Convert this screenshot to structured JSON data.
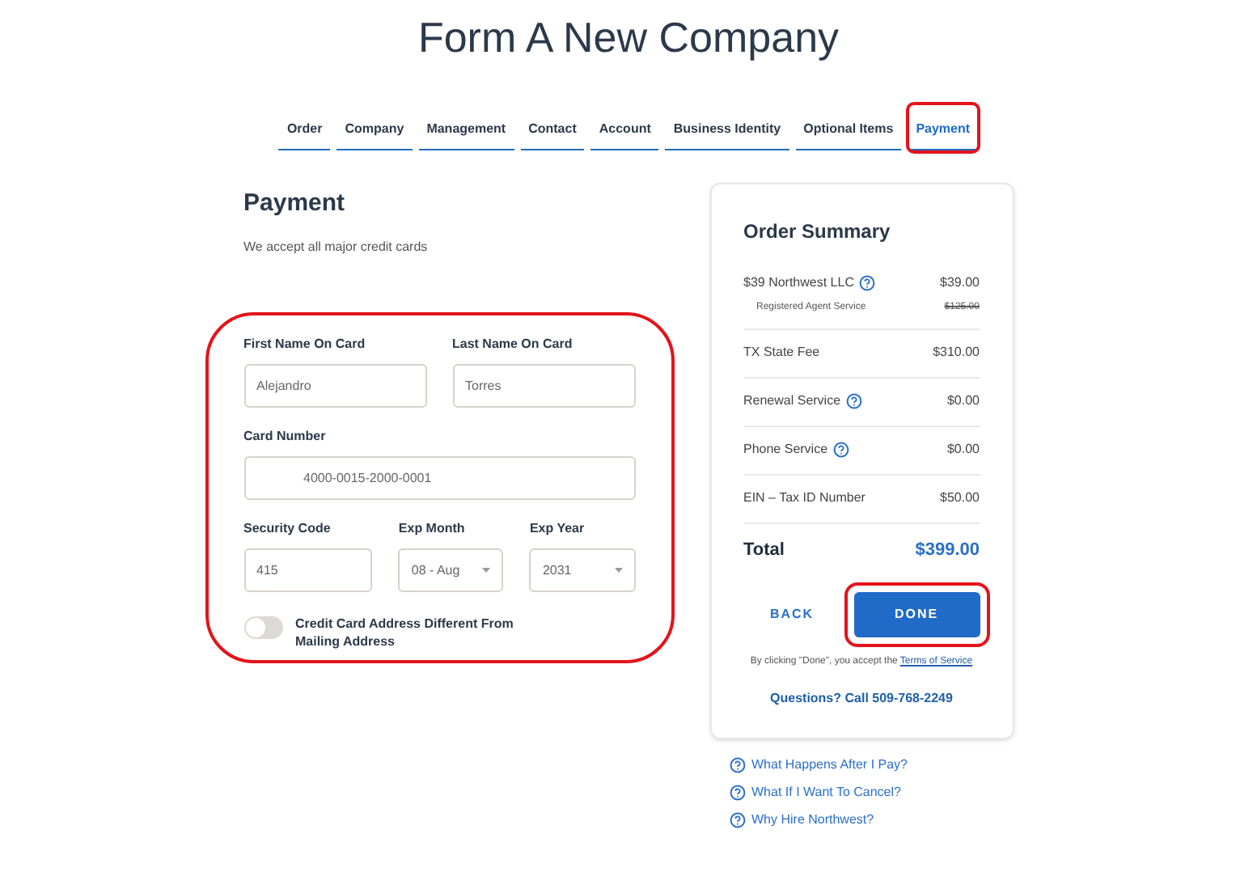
{
  "title": "Form A New Company",
  "tabs": [
    {
      "label": "Order",
      "selected": false,
      "highlighted": false
    },
    {
      "label": "Company",
      "selected": false,
      "highlighted": false
    },
    {
      "label": "Management",
      "selected": false,
      "highlighted": false
    },
    {
      "label": "Contact",
      "selected": false,
      "highlighted": false
    },
    {
      "label": "Account",
      "selected": false,
      "highlighted": false
    },
    {
      "label": "Business Identity",
      "selected": false,
      "highlighted": false
    },
    {
      "label": "Optional Items",
      "selected": false,
      "highlighted": false
    },
    {
      "label": "Payment",
      "selected": true,
      "highlighted": true
    }
  ],
  "payment": {
    "heading": "Payment",
    "note": "We accept all major credit cards"
  },
  "form": {
    "highlighted": true,
    "rows": [
      [
        {
          "label": "First Name On Card",
          "kind": "text",
          "value": "Alejandro"
        },
        {
          "label": "Last Name On Card",
          "kind": "text",
          "value": "Torres"
        }
      ],
      [
        {
          "label": "Card Number",
          "kind": "card",
          "value": "4000-0015-2000-0001"
        }
      ],
      [
        {
          "label": "Security Code",
          "kind": "text",
          "value": "415"
        },
        {
          "label": "Exp Month",
          "kind": "select",
          "value": "08 - Aug"
        },
        {
          "label": "Exp Year",
          "kind": "select",
          "value": "2031"
        }
      ]
    ],
    "toggle": {
      "label": "Credit Card Address Different From Mailing Address",
      "on": false
    }
  },
  "order_summary": {
    "heading": "Order Summary",
    "items": [
      {
        "kind": "item",
        "name": "$39 Northwest LLC",
        "amount": "$39.00",
        "info": true
      },
      {
        "kind": "sub",
        "name": "Registered Agent Service",
        "amount": "$125.00"
      },
      {
        "kind": "item",
        "name": "TX State Fee",
        "amount": "$310.00",
        "info": false
      },
      {
        "kind": "item",
        "name": "Renewal Service",
        "amount": "$0.00",
        "info": true
      },
      {
        "kind": "item",
        "name": "Phone Service",
        "amount": "$0.00",
        "info": true
      },
      {
        "kind": "item",
        "name": "EIN – Tax ID Number",
        "amount": "$50.00",
        "info": false
      }
    ],
    "total_label": "Total",
    "total": "$399.00",
    "back": "BACK",
    "done": {
      "label": "DONE",
      "highlighted": true
    },
    "terms_text": "By clicking \"Done\", you accept the",
    "terms_link": "Terms of Service",
    "questions": "Questions? Call 509-768-2249"
  },
  "help_links": [
    "What Happens After I Pay?",
    "What If I Want To Cancel?",
    "Why Hire Northwest?"
  ]
}
